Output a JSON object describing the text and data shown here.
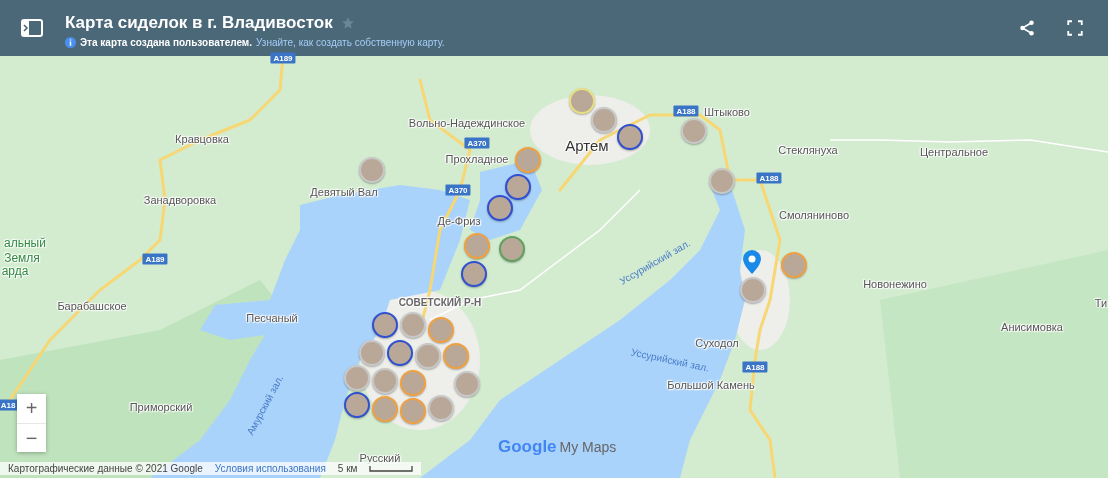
{
  "header": {
    "title": "Карта сиделок в г. Владивосток",
    "starred": false,
    "notice": "Эта карта создана пользователем.",
    "notice_link": "Узнайте, как создать собственную карту."
  },
  "map": {
    "labels": [
      {
        "text": "Кравцовка",
        "kind": "place"
      },
      {
        "text": "Занадворовка",
        "kind": "place"
      },
      {
        "text": "Вольно-Надеждинское",
        "kind": "place"
      },
      {
        "text": "Прохладное",
        "kind": "place"
      },
      {
        "text": "Девятый Вал",
        "kind": "place"
      },
      {
        "text": "Де-Фриз",
        "kind": "place"
      },
      {
        "text": "Артем",
        "kind": "city"
      },
      {
        "text": "Штыково",
        "kind": "place"
      },
      {
        "text": "Стеклянуха",
        "kind": "place"
      },
      {
        "text": "Центральное",
        "kind": "place"
      },
      {
        "text": "Смоляниново",
        "kind": "place"
      },
      {
        "text": "Новонежино",
        "kind": "place"
      },
      {
        "text": "Анисимовка",
        "kind": "place"
      },
      {
        "text": "Суходол",
        "kind": "place"
      },
      {
        "text": "Большой Камень",
        "kind": "place"
      },
      {
        "text": "Барабашское",
        "kind": "place"
      },
      {
        "text": "Песчаный",
        "kind": "place"
      },
      {
        "text": "Приморский",
        "kind": "place"
      },
      {
        "text": "Русский",
        "kind": "place"
      },
      {
        "text": "СОВЕТСКИЙ Р-Н",
        "kind": "district"
      },
      {
        "text": "Амурский зал.",
        "kind": "water"
      },
      {
        "text": "Уссурийский зал.",
        "kind": "water"
      },
      {
        "text": "Уссурийский зал.",
        "kind": "water"
      },
      {
        "text": "альный",
        "kind": "park"
      },
      {
        "text": "Земля",
        "kind": "park"
      },
      {
        "text": "арда",
        "kind": "park"
      },
      {
        "text": "Ти",
        "kind": "place"
      },
      {
        "text": "A189",
        "kind": "road"
      },
      {
        "text": "A189",
        "kind": "road"
      },
      {
        "text": "A370",
        "kind": "road"
      },
      {
        "text": "A370",
        "kind": "road"
      },
      {
        "text": "A188",
        "kind": "road"
      },
      {
        "text": "A188",
        "kind": "road"
      },
      {
        "text": "A188",
        "kind": "road"
      },
      {
        "text": "A18",
        "kind": "road"
      }
    ],
    "markers": [
      {
        "color": "#e8e080"
      },
      {
        "color": "#c8c8c8"
      },
      {
        "color": "#3050d0"
      },
      {
        "color": "#c8c8c8"
      },
      {
        "color": "#c8c8c8"
      },
      {
        "color": "#c8c8c8"
      },
      {
        "color": "#f0a040"
      },
      {
        "color": "#3050d0"
      },
      {
        "color": "#3050d0"
      },
      {
        "color": "#f0a040"
      },
      {
        "color": "#60a060"
      },
      {
        "color": "#3050d0"
      },
      {
        "color": "#c8c8c8"
      },
      {
        "color": "#f0a040"
      },
      {
        "color": "#3050d0"
      },
      {
        "color": "#c8c8c8"
      },
      {
        "color": "#f0a040"
      },
      {
        "color": "#c8c8c8"
      },
      {
        "color": "#3050d0"
      },
      {
        "color": "#c8c8c8"
      },
      {
        "color": "#c8c8c8"
      },
      {
        "color": "#f0a040"
      },
      {
        "color": "#3050d0"
      },
      {
        "color": "#f0a040"
      },
      {
        "color": "#f0a040"
      },
      {
        "color": "#c8c8c8"
      },
      {
        "color": "#c8c8c8"
      },
      {
        "color": "#c8c8c8"
      },
      {
        "color": "#f0a040"
      }
    ],
    "logo_google": "Google",
    "logo_product": "My Maps",
    "attribution": "Картографические данные © 2021 Google",
    "terms": "Условия использования",
    "scale": "5 км",
    "zoom_in": "+",
    "zoom_out": "−"
  }
}
